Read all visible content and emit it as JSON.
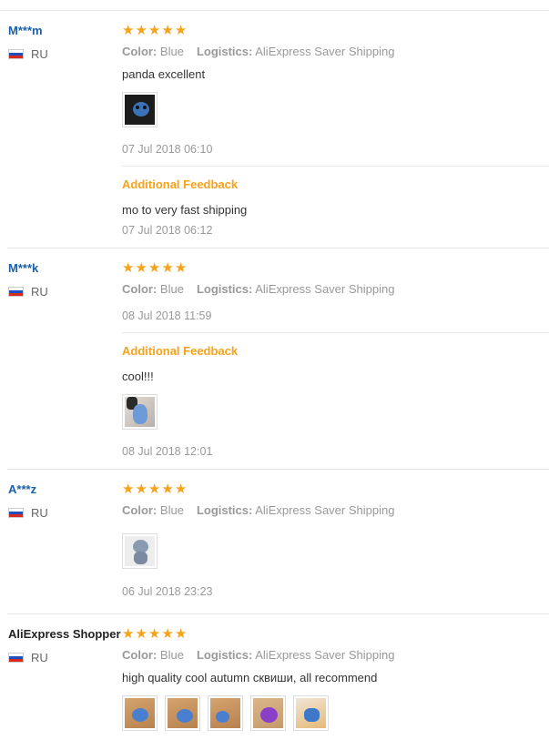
{
  "labels": {
    "color": "Color:",
    "logistics": "Logistics:",
    "additional_feedback": "Additional Feedback"
  },
  "colors": {
    "star": "#f7a21b",
    "username": "#1a5fa8",
    "muted": "#999999"
  },
  "reviews": [
    {
      "user": "M***m",
      "country": "RU",
      "rating": 5,
      "color": "Blue",
      "logistics": "AliExpress Saver Shipping",
      "text": "panda excellent",
      "date": "07 Jul 2018 06:10",
      "additional": {
        "text": "mo to very fast shipping",
        "date": "07 Jul 2018 06:12"
      }
    },
    {
      "user": "M***k",
      "country": "RU",
      "rating": 5,
      "color": "Blue",
      "logistics": "AliExpress Saver Shipping",
      "date": "08 Jul 2018 11:59",
      "additional": {
        "text": "cool!!!",
        "date": "08 Jul 2018 12:01"
      }
    },
    {
      "user": "A***z",
      "country": "RU",
      "rating": 5,
      "color": "Blue",
      "logistics": "AliExpress Saver Shipping",
      "date": "06 Jul 2018 23:23"
    },
    {
      "user": "AliExpress Shopper",
      "country": "RU",
      "rating": 5,
      "color": "Blue",
      "logistics": "AliExpress Saver Shipping",
      "text": "high quality cool autumn сквиши, all recommend"
    }
  ],
  "icons": {
    "flag": "russia-flag-icon",
    "star": "star-icon"
  }
}
